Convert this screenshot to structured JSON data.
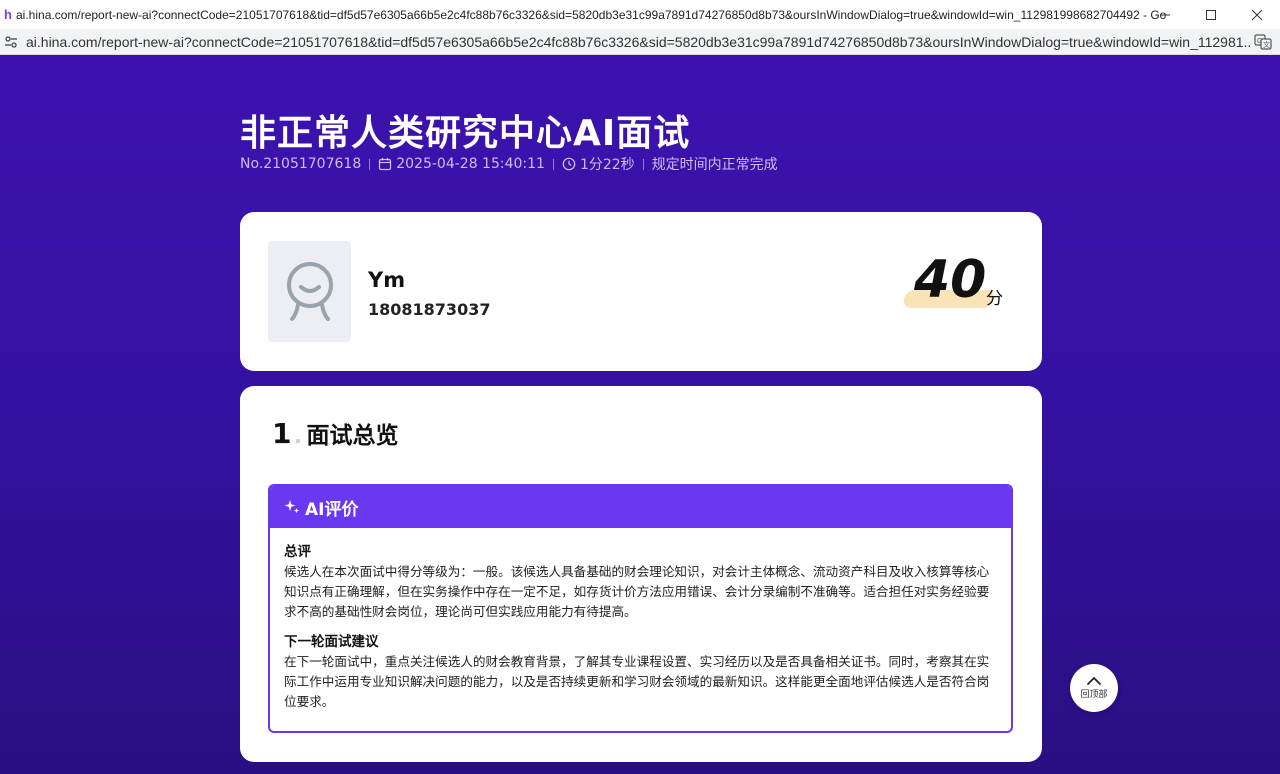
{
  "window": {
    "title": "ai.hina.com/report-new-ai?connectCode=21051707618&tid=df5d57e6305a66b5e2c4fc88b76c3326&sid=5820db3e31c99a7891d74276850d8b73&oursInWindowDialog=true&windowId=win_112981998682704492 - Go...",
    "url": "ai.hina.com/report-new-ai?connectCode=21051707618&tid=df5d57e6305a66b5e2c4fc88b76c3326&sid=5820db3e31c99a7891d74276850d8b73&oursInWindowDialog=true&windowId=win_112981...",
    "app_icon_letter": "h"
  },
  "report": {
    "title": "非正常人类研究中心AI面试",
    "number": "No.21051707618",
    "datetime": "2025-04-28 15:40:11",
    "duration": "1分22秒",
    "status": "规定时间内正常完成"
  },
  "candidate": {
    "name": "Ym",
    "phone": "18081873037",
    "score": "40",
    "score_unit": "分"
  },
  "overview": {
    "section_number": "1",
    "section_title": "面试总览",
    "ai_eval_title": "AI评价",
    "summary_label": "总评",
    "summary_text": "候选人在本次面试中得分等级为：一般。该候选人具备基础的财会理论知识，对会计主体概念、流动资产科目及收入核算等核心知识点有正确理解，但在实务操作中存在一定不足，如存货计价方法应用错误、会计分录编制不准确等。适合担任对实务经验要求不高的基础性财会岗位，理论尚可但实践应用能力有待提高。",
    "next_round_label": "下一轮面试建议",
    "next_round_text": "在下一轮面试中，重点关注候选人的财会教育背景，了解其专业课程设置、实习经历以及是否具备相关证书。同时，考察其在实际工作中运用专业知识解决问题的能力，以及是否持续更新和学习财会领域的最新知识。这样能更全面地评估候选人是否符合岗位要求。"
  },
  "back_to_top": {
    "label": "回顶部"
  },
  "colors": {
    "page_bg": "#3a14a8",
    "accent": "#6b38f2",
    "score_highlight": "#fbe3b8"
  }
}
